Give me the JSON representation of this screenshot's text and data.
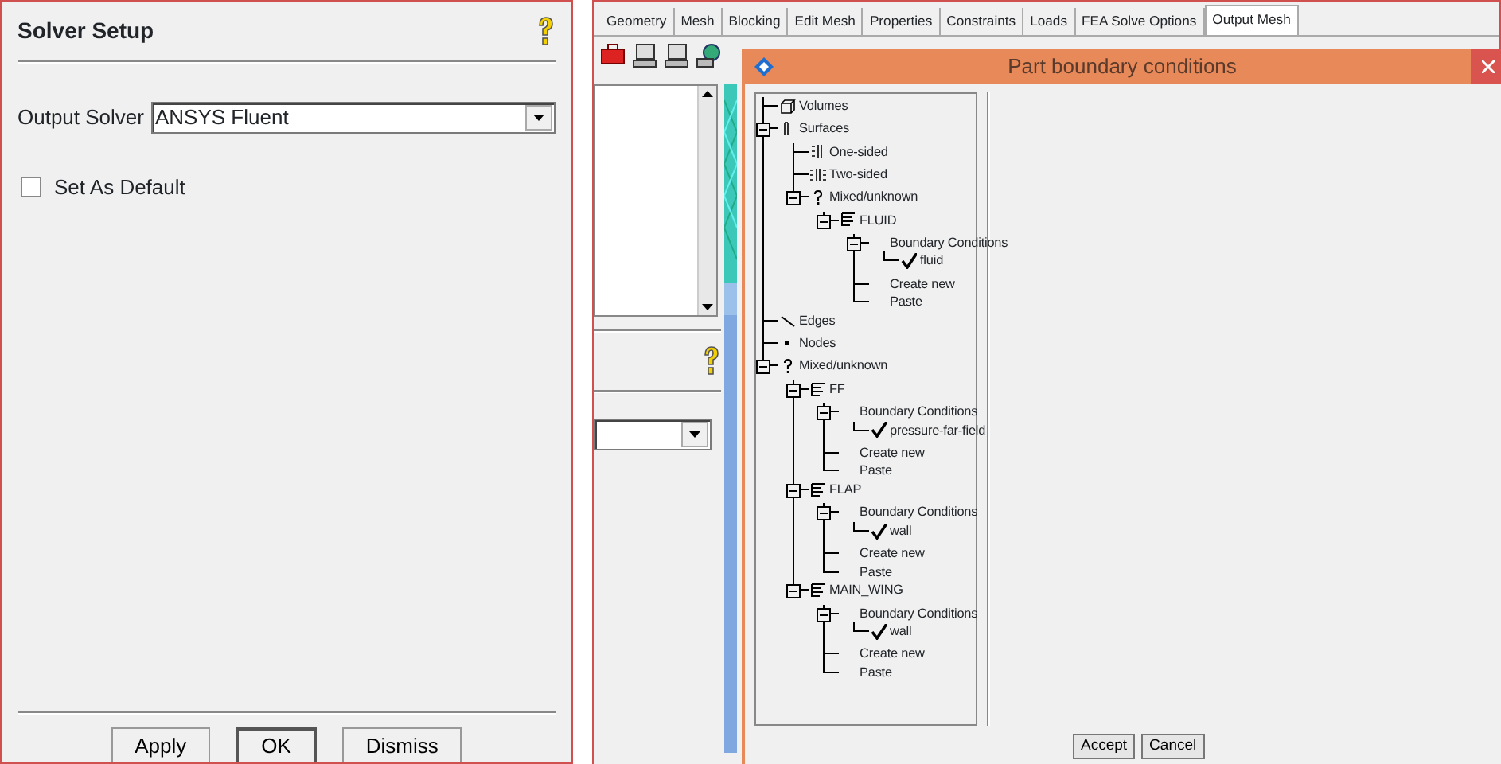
{
  "solver_setup": {
    "title": "Solver Setup",
    "output_solver": {
      "label": "Output Solver",
      "value": "ANSYS Fluent"
    },
    "set_as_default": {
      "label": "Set As Default",
      "checked": false
    },
    "buttons": [
      {
        "label": "Apply",
        "focused": false
      },
      {
        "label": "OK",
        "focused": true
      },
      {
        "label": "Dismiss",
        "focused": false
      }
    ]
  },
  "tabs": [
    {
      "label": "Geometry",
      "selected": false
    },
    {
      "label": "Mesh",
      "selected": false
    },
    {
      "label": "Blocking",
      "selected": false
    },
    {
      "label": "Edit Mesh",
      "selected": false
    },
    {
      "label": "Properties",
      "selected": false
    },
    {
      "label": "Constraints",
      "selected": false
    },
    {
      "label": "Loads",
      "selected": false
    },
    {
      "label": "FEA Solve Options",
      "selected": false
    },
    {
      "label": "Output Mesh",
      "selected": true
    }
  ],
  "dialog": {
    "title": "Part boundary conditions",
    "tree": [
      {
        "label": "Volumes",
        "kind": "volume"
      },
      {
        "label": "Surfaces",
        "kind": "surface",
        "expanded": true,
        "children": [
          {
            "label": "One-sided",
            "kind": "one-sided"
          },
          {
            "label": "Two-sided",
            "kind": "two-sided"
          },
          {
            "label": "Mixed/unknown",
            "kind": "mixed",
            "expanded": true,
            "children": [
              {
                "label": "FLUID",
                "kind": "part",
                "expanded": true,
                "children": [
                  {
                    "label": "Boundary Conditions",
                    "kind": "group",
                    "expanded": true,
                    "children": [
                      {
                        "label": "fluid",
                        "kind": "condition"
                      }
                    ]
                  },
                  {
                    "label": "Create new",
                    "kind": "action"
                  },
                  {
                    "label": "Paste",
                    "kind": "action"
                  }
                ]
              }
            ]
          }
        ]
      },
      {
        "label": "Edges",
        "kind": "edge"
      },
      {
        "label": "Nodes",
        "kind": "node"
      },
      {
        "label": "Mixed/unknown",
        "kind": "mixed",
        "expanded": true,
        "children": [
          {
            "label": "FF",
            "kind": "part",
            "expanded": true,
            "children": [
              {
                "label": "Boundary Conditions",
                "kind": "group",
                "expanded": true,
                "children": [
                  {
                    "label": "pressure-far-field",
                    "kind": "condition"
                  }
                ]
              },
              {
                "label": "Create new",
                "kind": "action"
              },
              {
                "label": "Paste",
                "kind": "action"
              }
            ]
          },
          {
            "label": "FLAP",
            "kind": "part",
            "expanded": true,
            "children": [
              {
                "label": "Boundary Conditions",
                "kind": "group",
                "expanded": true,
                "children": [
                  {
                    "label": "wall",
                    "kind": "condition"
                  }
                ]
              },
              {
                "label": "Create new",
                "kind": "action"
              },
              {
                "label": "Paste",
                "kind": "action"
              }
            ]
          },
          {
            "label": "MAIN_WING",
            "kind": "part",
            "expanded": true,
            "children": [
              {
                "label": "Boundary Conditions",
                "kind": "group",
                "expanded": true,
                "children": [
                  {
                    "label": "wall",
                    "kind": "condition"
                  }
                ]
              },
              {
                "label": "Create new",
                "kind": "action"
              },
              {
                "label": "Paste",
                "kind": "action"
              }
            ]
          }
        ]
      }
    ],
    "buttons": [
      {
        "label": "Accept"
      },
      {
        "label": "Cancel"
      }
    ]
  }
}
